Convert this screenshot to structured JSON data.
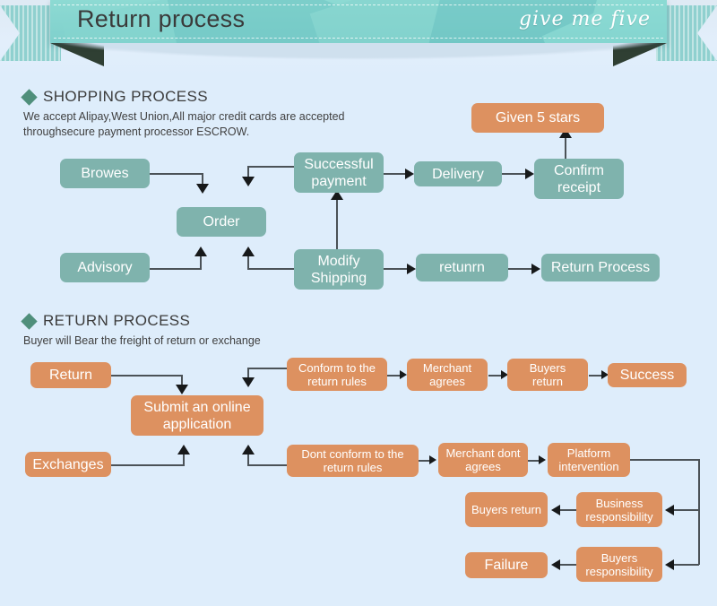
{
  "header": {
    "title": "Return process",
    "script_text": "give me five",
    "ribbon_color": "#7fd0cc",
    "page_background": "#deedfb"
  },
  "colors": {
    "teal_box": "#7fb3ad",
    "orange_box": "#dd9160",
    "diamond": "#4f8f7b",
    "connector": "#4b5257",
    "text_on_box": "#ffffff"
  },
  "shopping_section": {
    "heading": "SHOPPING PROCESS",
    "description": "We accept Alipay,West Union,All major credit cards are accepted throughsecure payment processor ESCROW.",
    "description_line1": "We accept Alipay,West Union,All major credit cards are accepted",
    "description_line2": "throughsecure payment processor ESCROW.",
    "nodes": [
      {
        "id": "browes",
        "label": "Browes",
        "color": "teal"
      },
      {
        "id": "order",
        "label": "Order",
        "color": "teal"
      },
      {
        "id": "advisory",
        "label": "Advisory",
        "color": "teal"
      },
      {
        "id": "successful-payment",
        "label": "Successful payment",
        "color": "teal"
      },
      {
        "id": "modify-shipping",
        "label": "Modify Shipping",
        "color": "teal"
      },
      {
        "id": "delivery",
        "label": "Delivery",
        "color": "teal"
      },
      {
        "id": "confirm-receipt",
        "label": "Confirm receipt",
        "color": "teal"
      },
      {
        "id": "given-5-stars",
        "label": "Given 5 stars",
        "color": "orange"
      },
      {
        "id": "retunrn",
        "label": "retunrn",
        "color": "teal"
      },
      {
        "id": "return-process",
        "label": "Return Process",
        "color": "teal"
      }
    ]
  },
  "return_section": {
    "heading": "RETURN PROCESS",
    "description": "Buyer will Bear the freight of return or exchange",
    "nodes": [
      {
        "id": "return",
        "label": "Return",
        "color": "orange"
      },
      {
        "id": "submit-application",
        "label": "Submit an online application",
        "color": "orange"
      },
      {
        "id": "conform-rules",
        "label": "Conform to the return rules",
        "color": "orange"
      },
      {
        "id": "merchant-agrees",
        "label": "Merchant agrees",
        "color": "orange"
      },
      {
        "id": "buyers-return-top",
        "label": "Buyers return",
        "color": "orange"
      },
      {
        "id": "success",
        "label": "Success",
        "color": "orange"
      },
      {
        "id": "exchanges",
        "label": "Exchanges",
        "color": "orange"
      },
      {
        "id": "dont-conform-rules",
        "label": "Dont conform to the return rules",
        "color": "orange"
      },
      {
        "id": "merchant-dont-agrees",
        "label": "Merchant dont agrees",
        "color": "orange"
      },
      {
        "id": "platform-intervention",
        "label": "Platform intervention",
        "color": "orange"
      },
      {
        "id": "business-responsibility",
        "label": "Business responsibility",
        "color": "orange"
      },
      {
        "id": "buyers-return-bottom",
        "label": "Buyers return",
        "color": "orange"
      },
      {
        "id": "buyers-responsibility",
        "label": "Buyers responsibility",
        "color": "orange"
      },
      {
        "id": "failure",
        "label": "Failure",
        "color": "orange"
      }
    ]
  }
}
